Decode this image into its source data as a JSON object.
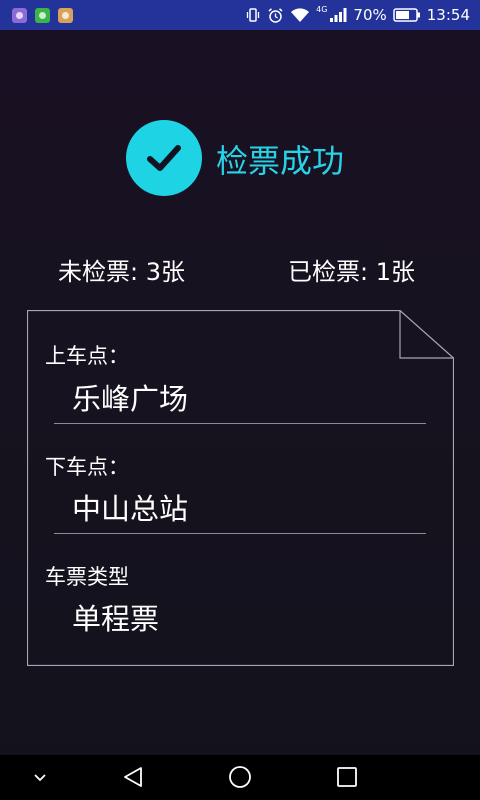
{
  "status_bar": {
    "notification_icons": [
      "gallery-icon",
      "wechat-icon",
      "app-icon"
    ],
    "network_type": "4G",
    "battery_percent": "70%",
    "battery_level": 0.7,
    "time": "13:54",
    "background_color": "#24339a"
  },
  "header": {
    "title": "检票成功",
    "accent_color": "#1ed4e4"
  },
  "counts": {
    "unchecked": "未检票: 3张",
    "checked": "已检票: 1张"
  },
  "ticket": {
    "boarding_label": "上车点：",
    "boarding_value": "乐峰广场",
    "alighting_label": "下车点：",
    "alighting_value": "中山总站",
    "type_label": "车票类型",
    "type_value": "单程票"
  },
  "nav_bar": {
    "buttons": [
      "collapse-icon",
      "back-icon",
      "home-icon",
      "recent-apps-icon"
    ]
  }
}
